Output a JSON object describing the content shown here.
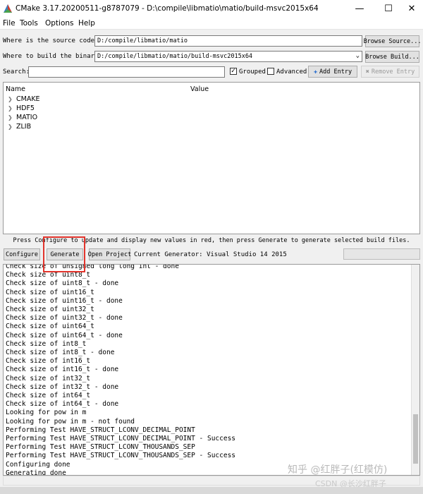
{
  "window": {
    "title": "CMake 3.17.20200511-g8787079 - D:\\compile\\libmatio\\matio/build-msvc2015x64"
  },
  "menu": [
    "File",
    "Tools",
    "Options",
    "Help"
  ],
  "source": {
    "label": "Where is the source code:",
    "value": "D:/compile/libmatio/matio",
    "button": "Browse Source..."
  },
  "build": {
    "label": "Where to build the binaries:",
    "value": "D:/compile/libmatio/matio/build-msvc2015x64",
    "button": "Browse Build..."
  },
  "search": {
    "label": "Search:",
    "value": ""
  },
  "options": {
    "grouped": "Grouped",
    "advanced": "Advanced",
    "grouped_checked": true,
    "advanced_checked": false
  },
  "entry_buttons": {
    "add": "Add Entry",
    "remove": "Remove Entry"
  },
  "tree": {
    "columns": [
      "Name",
      "Value"
    ],
    "groups": [
      "CMAKE",
      "HDF5",
      "MATIO",
      "ZLIB"
    ]
  },
  "hint": "Press Configure to update and display new values in red, then press Generate to generate selected build files.",
  "actions": {
    "configure": "Configure",
    "generate": "Generate",
    "open_project": "Open Project",
    "generator": "Current Generator: Visual Studio 14 2015"
  },
  "output": [
    "Check size of unsigned long long int - done",
    "Check size of uint8_t",
    "Check size of uint8_t - done",
    "Check size of uint16_t",
    "Check size of uint16_t - done",
    "Check size of uint32_t",
    "Check size of uint32_t - done",
    "Check size of uint64_t",
    "Check size of uint64_t - done",
    "Check size of int8_t",
    "Check size of int8_t - done",
    "Check size of int16_t",
    "Check size of int16_t - done",
    "Check size of int32_t",
    "Check size of int32_t - done",
    "Check size of int64_t",
    "Check size of int64_t - done",
    "Looking for pow in m",
    "Looking for pow in m - not found",
    "Performing Test HAVE_STRUCT_LCONV_DECIMAL_POINT",
    "Performing Test HAVE_STRUCT_LCONV_DECIMAL_POINT - Success",
    "Performing Test HAVE_STRUCT_LCONV_THOUSANDS_SEP",
    "Performing Test HAVE_STRUCT_LCONV_THOUSANDS_SEP - Success",
    "Configuring done",
    "Generating done"
  ],
  "watermark": {
    "line1": "知乎 @红胖子(红模仿)",
    "line2": "CSDN @长沙红胖子"
  },
  "colors": {
    "highlight": "#e2342c",
    "progress_bg": "#e6e6e6"
  }
}
